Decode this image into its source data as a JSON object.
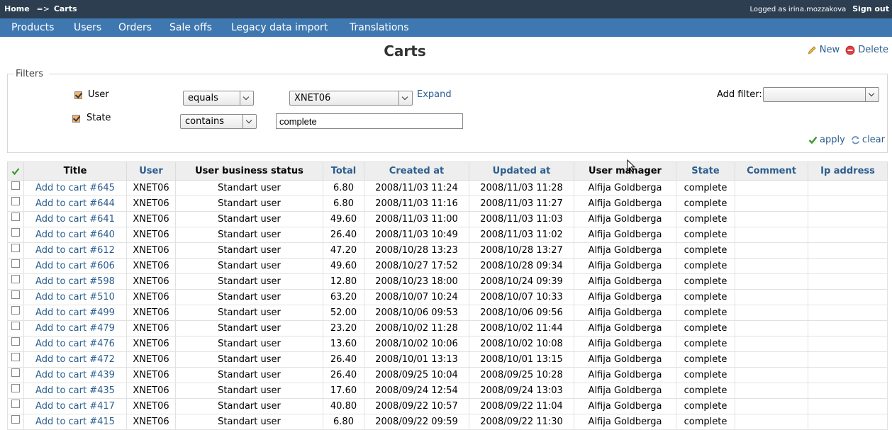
{
  "topbar": {
    "home": "Home",
    "separator": "=>",
    "current": "Carts",
    "logged_as": "Logged as irina.mozzakova",
    "sign_out": "Sign out"
  },
  "nav": [
    "Products",
    "Users",
    "Orders",
    "Sale offs",
    "Legacy data import",
    "Translations"
  ],
  "page": {
    "title": "Carts",
    "new_label": "New",
    "delete_label": "Delete"
  },
  "filters": {
    "legend": "Filters",
    "user": {
      "label": "User",
      "operator": "equals",
      "value": "XNET06",
      "expand": "Expand"
    },
    "state": {
      "label": "State",
      "operator": "contains",
      "value": "complete"
    },
    "add_filter_label": "Add filter:",
    "add_filter_value": "",
    "apply": "apply",
    "clear": "clear"
  },
  "table": {
    "columns": [
      "Title",
      "User",
      "User business status",
      "Total",
      "Created at",
      "Updated at",
      "User manager",
      "State",
      "Comment",
      "Ip address"
    ],
    "rows": [
      [
        "Add to cart #645",
        "XNET06",
        "Standart user",
        "6.80",
        "2008/11/03 11:24",
        "2008/11/03 11:28",
        "Alfija Goldberga",
        "complete",
        "",
        ""
      ],
      [
        "Add to cart #644",
        "XNET06",
        "Standart user",
        "6.80",
        "2008/11/03 11:16",
        "2008/11/03 11:27",
        "Alfija Goldberga",
        "complete",
        "",
        ""
      ],
      [
        "Add to cart #641",
        "XNET06",
        "Standart user",
        "49.60",
        "2008/11/03 11:00",
        "2008/11/03 11:03",
        "Alfija Goldberga",
        "complete",
        "",
        ""
      ],
      [
        "Add to cart #640",
        "XNET06",
        "Standart user",
        "26.40",
        "2008/11/03 10:49",
        "2008/11/03 11:02",
        "Alfija Goldberga",
        "complete",
        "",
        ""
      ],
      [
        "Add to cart #612",
        "XNET06",
        "Standart user",
        "47.20",
        "2008/10/28 13:23",
        "2008/10/28 13:27",
        "Alfija Goldberga",
        "complete",
        "",
        ""
      ],
      [
        "Add to cart #606",
        "XNET06",
        "Standart user",
        "49.60",
        "2008/10/27 17:52",
        "2008/10/28 09:34",
        "Alfija Goldberga",
        "complete",
        "",
        ""
      ],
      [
        "Add to cart #598",
        "XNET06",
        "Standart user",
        "12.80",
        "2008/10/23 18:00",
        "2008/10/24 09:39",
        "Alfija Goldberga",
        "complete",
        "",
        ""
      ],
      [
        "Add to cart #510",
        "XNET06",
        "Standart user",
        "63.20",
        "2008/10/07 10:24",
        "2008/10/07 10:33",
        "Alfija Goldberga",
        "complete",
        "",
        ""
      ],
      [
        "Add to cart #499",
        "XNET06",
        "Standart user",
        "52.00",
        "2008/10/06 09:53",
        "2008/10/06 09:56",
        "Alfija Goldberga",
        "complete",
        "",
        ""
      ],
      [
        "Add to cart #479",
        "XNET06",
        "Standart user",
        "23.20",
        "2008/10/02 11:28",
        "2008/10/02 11:44",
        "Alfija Goldberga",
        "complete",
        "",
        ""
      ],
      [
        "Add to cart #476",
        "XNET06",
        "Standart user",
        "13.60",
        "2008/10/02 10:06",
        "2008/10/02 10:08",
        "Alfija Goldberga",
        "complete",
        "",
        ""
      ],
      [
        "Add to cart #472",
        "XNET06",
        "Standart user",
        "26.40",
        "2008/10/01 13:13",
        "2008/10/01 13:15",
        "Alfija Goldberga",
        "complete",
        "",
        ""
      ],
      [
        "Add to cart #439",
        "XNET06",
        "Standart user",
        "26.40",
        "2008/09/25 10:04",
        "2008/09/25 10:28",
        "Alfija Goldberga",
        "complete",
        "",
        ""
      ],
      [
        "Add to cart #435",
        "XNET06",
        "Standart user",
        "17.60",
        "2008/09/24 12:54",
        "2008/09/24 13:03",
        "Alfija Goldberga",
        "complete",
        "",
        ""
      ],
      [
        "Add to cart #417",
        "XNET06",
        "Standart user",
        "40.80",
        "2008/09/22 10:57",
        "2008/09/22 11:04",
        "Alfija Goldberga",
        "complete",
        "",
        ""
      ],
      [
        "Add to cart #415",
        "XNET06",
        "Standart user",
        "6.80",
        "2008/09/22 09:59",
        "2008/09/22 11:30",
        "Alfija Goldberga",
        "complete",
        "",
        ""
      ]
    ]
  }
}
